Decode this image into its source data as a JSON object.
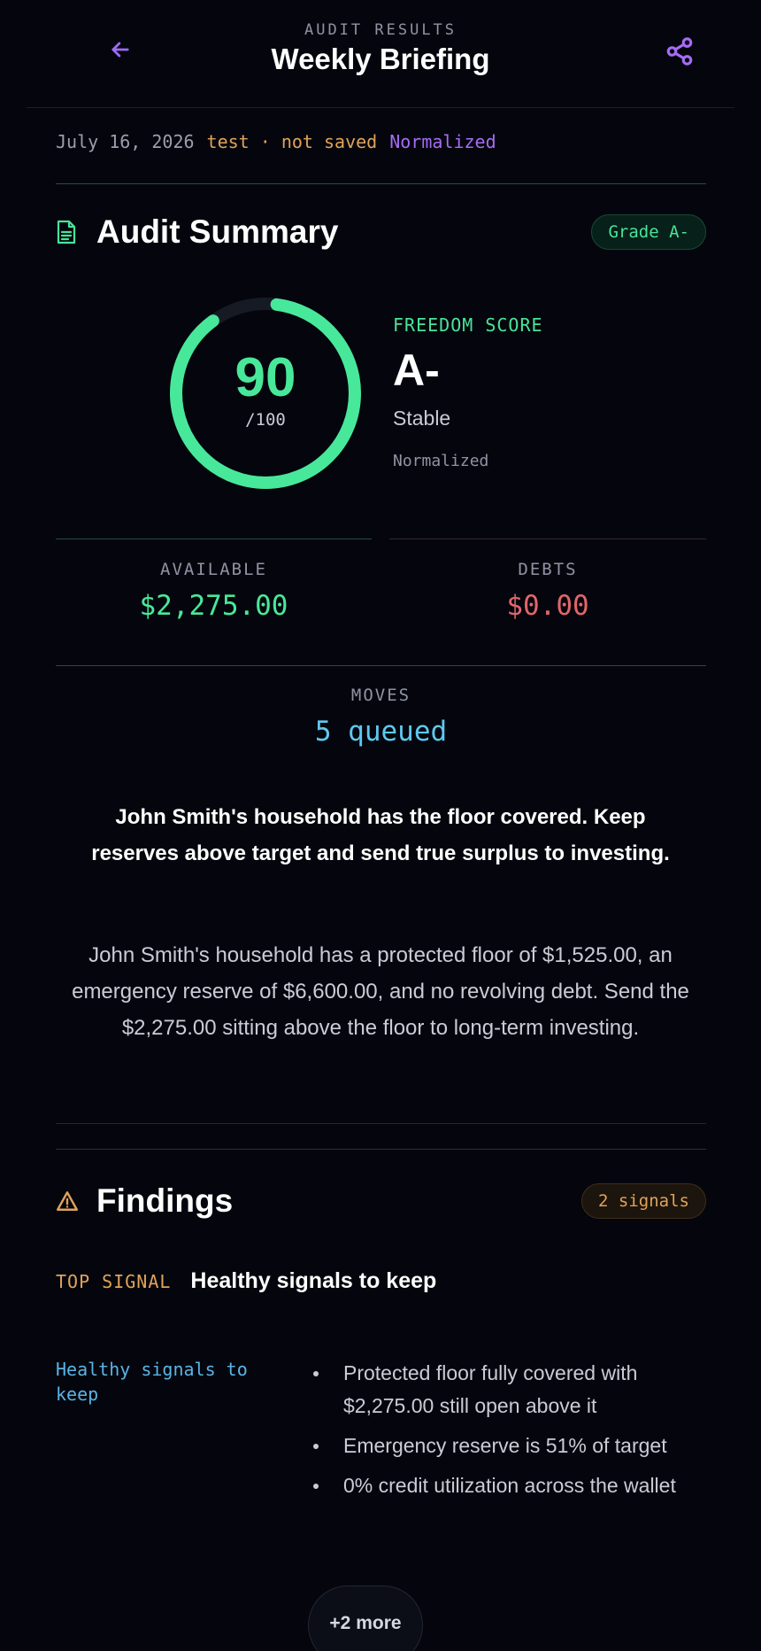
{
  "header": {
    "eyebrow": "AUDIT RESULTS",
    "title": "Weekly Briefing",
    "back_icon": "arrow-left-icon",
    "share_icon": "share-icon"
  },
  "meta": {
    "date": "July 16, 2026",
    "status": "test · not saved",
    "mode": "Normalized"
  },
  "summary_section": {
    "title": "Audit Summary",
    "icon": "document-icon",
    "badge": "Grade A-"
  },
  "score": {
    "value": "90",
    "max_label": "/100",
    "fraction": 0.9,
    "label": "FREEDOM SCORE",
    "grade": "A-",
    "state": "Stable",
    "mode": "Normalized"
  },
  "stats": {
    "available_label": "AVAILABLE",
    "available_value": "$2,275.00",
    "debts_label": "DEBTS",
    "debts_value": "$0.00",
    "moves_label": "MOVES",
    "moves_value": "5 queued"
  },
  "summary": {
    "headline": "John Smith's household has the floor covered. Keep reserves above target and send true surplus to investing.",
    "body": "John Smith's household has a protected floor of $1,525.00, an emergency reserve of $6,600.00, and no revolving debt. Send the $2,275.00 sitting above the floor to long-term investing."
  },
  "findings": {
    "title": "Findings",
    "icon": "warning-icon",
    "badge": "2 signals",
    "top_signal_label": "TOP SIGNAL",
    "top_signal_text": "Healthy signals to keep",
    "group_title": "Healthy signals to keep",
    "items": [
      "Protected floor fully covered with $2,275.00 still open above it",
      "Emergency reserve is 51% of target",
      "0% credit utilization across the wallet"
    ],
    "more_label": "+2 more"
  },
  "colors": {
    "accent_green": "#48e89a",
    "accent_purple": "#a56cf5",
    "accent_amber": "#e0a35a",
    "accent_blue": "#5ab3e6",
    "debt_red": "#e0666b"
  }
}
